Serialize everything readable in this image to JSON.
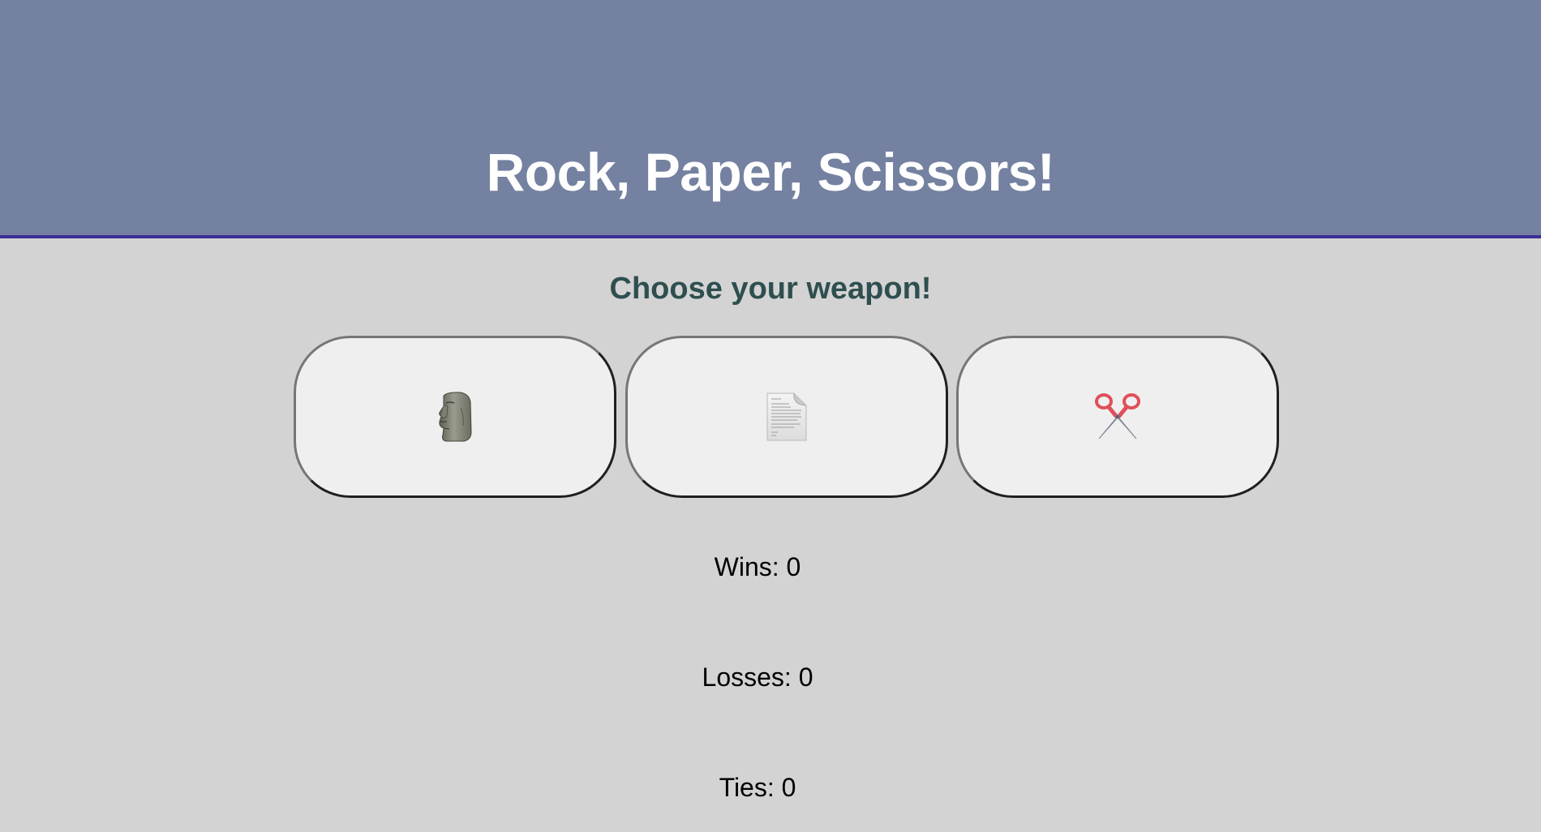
{
  "header": {
    "title": "Rock, Paper, Scissors!",
    "background_color": "#7481a0",
    "border_color": "#3b2f98"
  },
  "main": {
    "prompt": "Choose your weapon!",
    "prompt_color": "#2f4f4f",
    "weapons": [
      {
        "name": "rock",
        "icon": "moai-icon"
      },
      {
        "name": "paper",
        "icon": "page-icon"
      },
      {
        "name": "scissors",
        "icon": "scissors-icon"
      }
    ]
  },
  "scores": {
    "wins_label": "Wins:",
    "wins": "0",
    "losses_label": "Losses:",
    "losses": "0",
    "ties_label": "Ties:",
    "ties": "0"
  }
}
